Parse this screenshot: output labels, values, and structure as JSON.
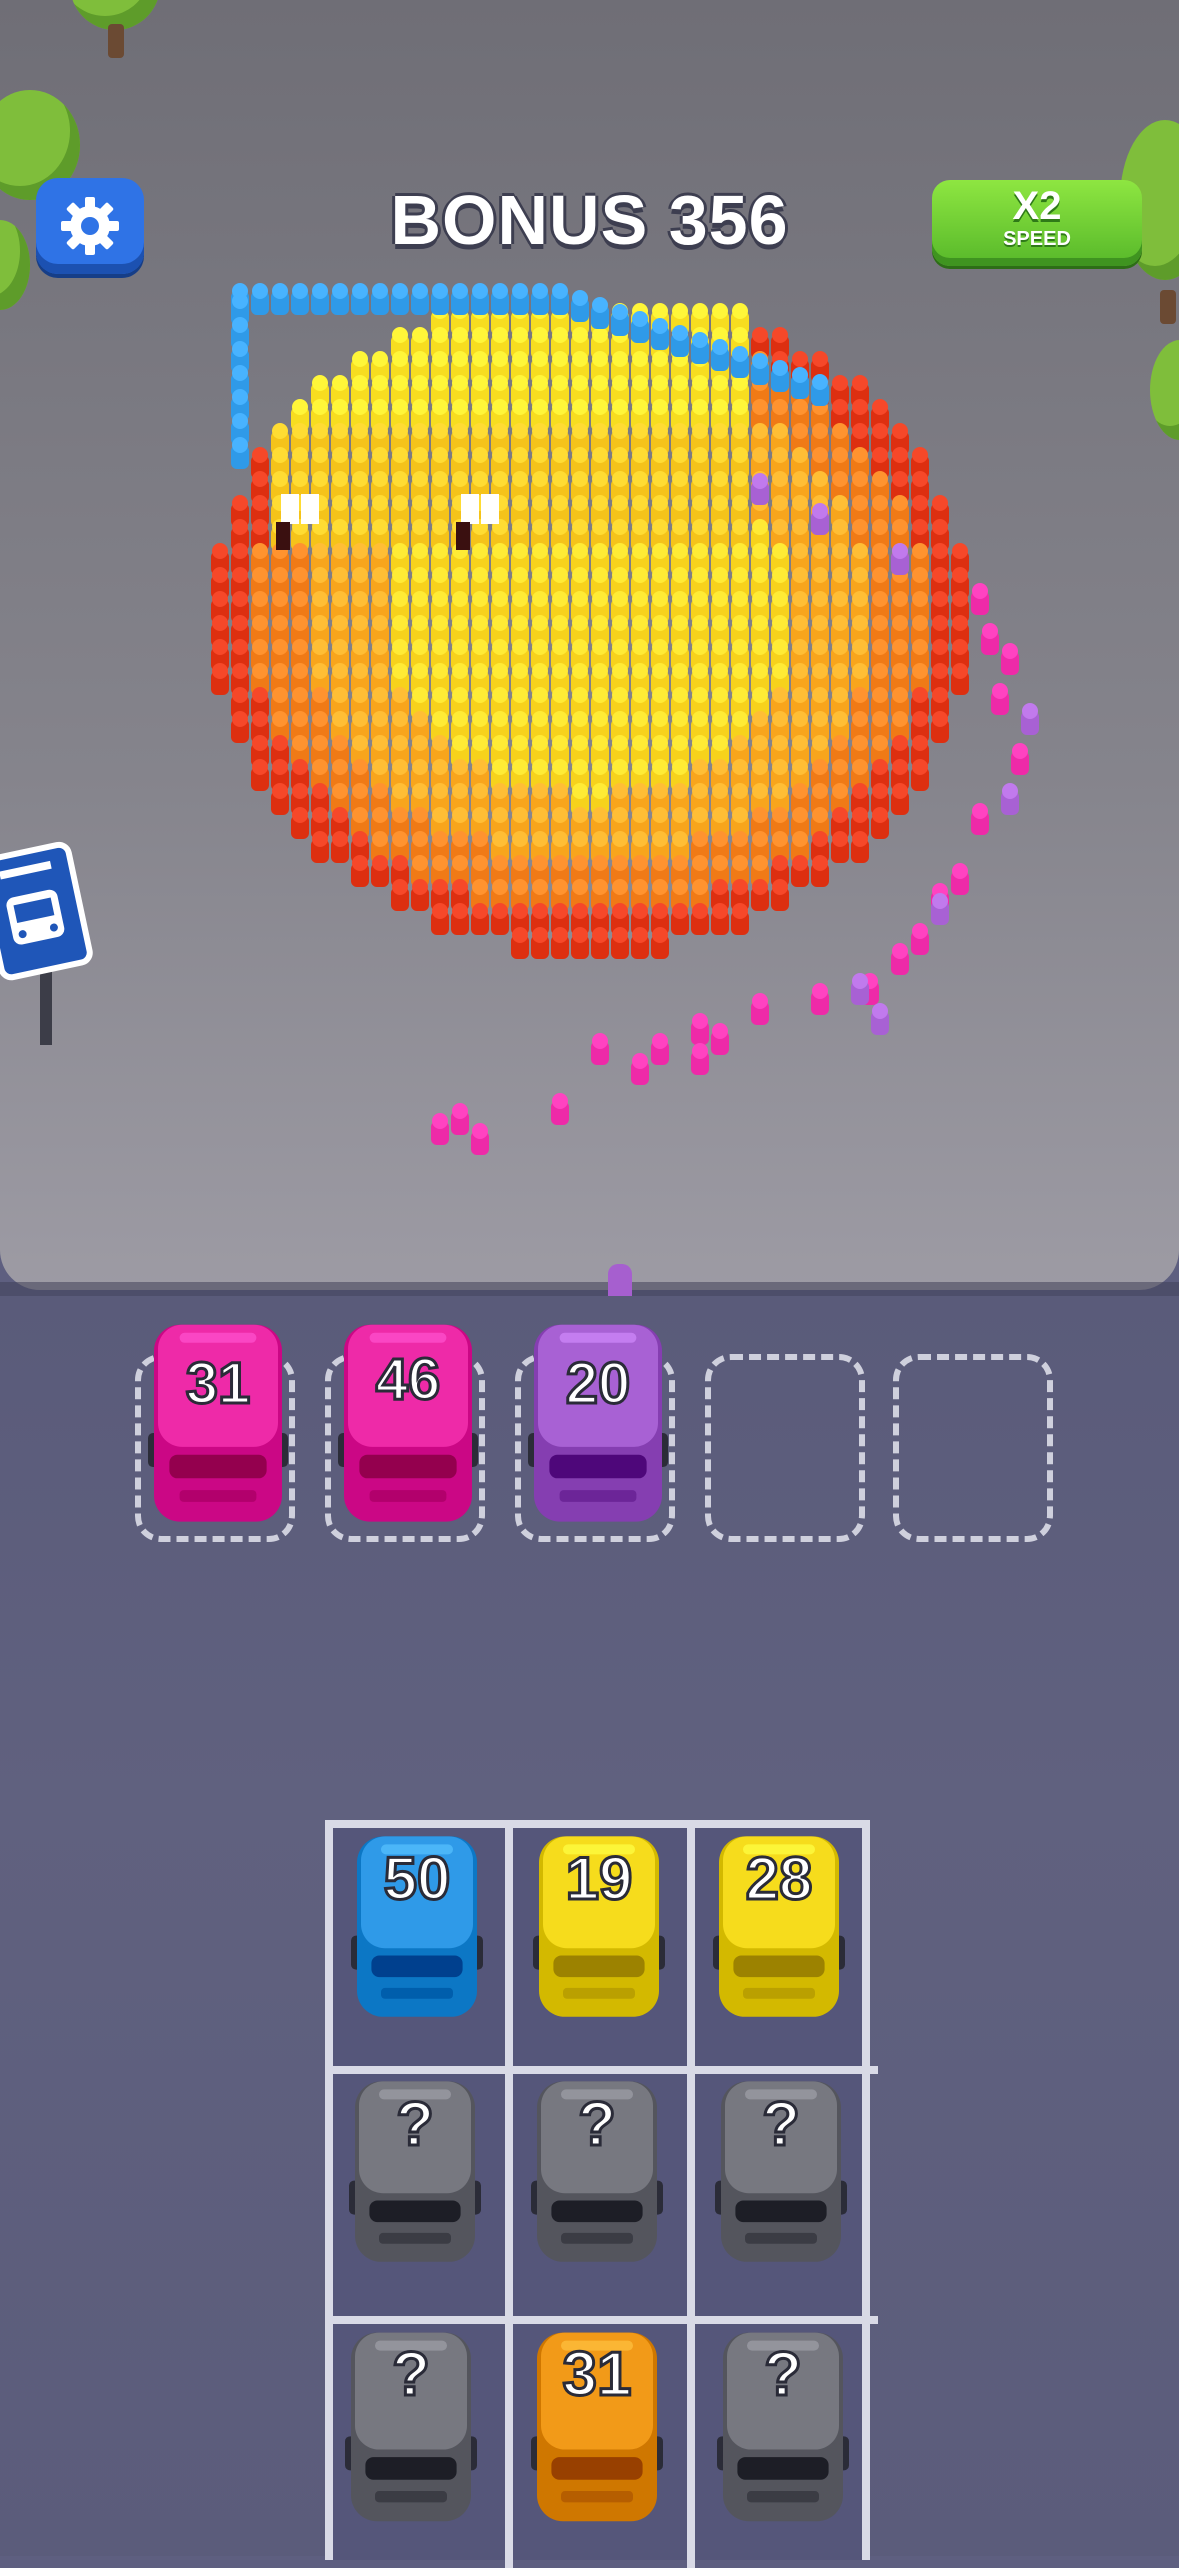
{
  "hud": {
    "bonus_label": "BONUS 356",
    "speed_multiplier": "X2",
    "speed_caption": "SPEED"
  },
  "icons": {
    "settings": "gear-icon",
    "bus_stop": "bus-icon"
  },
  "colors": {
    "pink": "#ee2aa8",
    "purple": "#a861d4",
    "blue": "#2f9ae8",
    "yellow": "#f6dc1c",
    "orange": "#f29a18",
    "gray": "#777880",
    "speed_green": "#6fd034",
    "settings_blue": "#2f73e6"
  },
  "parking_slots": [
    {
      "color": "pink",
      "count": "31"
    },
    {
      "color": "pink",
      "count": "46"
    },
    {
      "color": "purple",
      "count": "20"
    },
    {
      "empty": true
    },
    {
      "empty": true
    }
  ],
  "garage": [
    [
      {
        "color": "blue",
        "count": "50"
      },
      {
        "color": "yellow",
        "count": "19"
      },
      {
        "color": "yellow",
        "count": "28"
      }
    ],
    [
      {
        "color": "gray",
        "count": "?"
      },
      {
        "color": "gray",
        "count": "?"
      },
      {
        "color": "gray",
        "count": "?"
      }
    ],
    [
      {
        "color": "gray",
        "count": "?"
      },
      {
        "color": "orange",
        "count": "31"
      },
      {
        "color": "gray",
        "count": "?"
      }
    ]
  ]
}
